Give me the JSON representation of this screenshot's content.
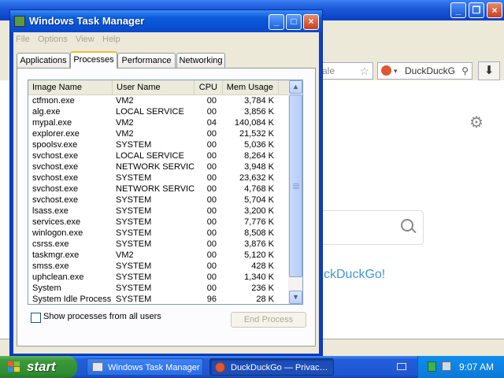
{
  "background_browser": {
    "url_fragment": "ale",
    "search_engine_label": "DuckDuckG",
    "tagline": "ckDuckGo!"
  },
  "task_manager": {
    "title": "Windows Task Manager",
    "menu": [
      "File",
      "Options",
      "View",
      "Help"
    ],
    "tabs": [
      "Applications",
      "Processes",
      "Performance",
      "Networking"
    ],
    "active_tab": "Processes",
    "columns": [
      "Image Name",
      "User Name",
      "CPU",
      "Mem Usage"
    ],
    "processes": [
      {
        "image": "ctfmon.exe",
        "user": "VM2",
        "cpu": "00",
        "mem": "3,784 K"
      },
      {
        "image": "alg.exe",
        "user": "LOCAL SERVICE",
        "cpu": "00",
        "mem": "3,856 K"
      },
      {
        "image": "mypal.exe",
        "user": "VM2",
        "cpu": "04",
        "mem": "140,084 K"
      },
      {
        "image": "explorer.exe",
        "user": "VM2",
        "cpu": "00",
        "mem": "21,532 K"
      },
      {
        "image": "spoolsv.exe",
        "user": "SYSTEM",
        "cpu": "00",
        "mem": "5,036 K"
      },
      {
        "image": "svchost.exe",
        "user": "LOCAL SERVICE",
        "cpu": "00",
        "mem": "8,264 K"
      },
      {
        "image": "svchost.exe",
        "user": "NETWORK SERVICE",
        "cpu": "00",
        "mem": "3,948 K"
      },
      {
        "image": "svchost.exe",
        "user": "SYSTEM",
        "cpu": "00",
        "mem": "23,632 K"
      },
      {
        "image": "svchost.exe",
        "user": "NETWORK SERVICE",
        "cpu": "00",
        "mem": "4,768 K"
      },
      {
        "image": "svchost.exe",
        "user": "SYSTEM",
        "cpu": "00",
        "mem": "5,704 K"
      },
      {
        "image": "lsass.exe",
        "user": "SYSTEM",
        "cpu": "00",
        "mem": "3,200 K"
      },
      {
        "image": "services.exe",
        "user": "SYSTEM",
        "cpu": "00",
        "mem": "7,776 K"
      },
      {
        "image": "winlogon.exe",
        "user": "SYSTEM",
        "cpu": "00",
        "mem": "8,508 K"
      },
      {
        "image": "csrss.exe",
        "user": "SYSTEM",
        "cpu": "00",
        "mem": "3,876 K"
      },
      {
        "image": "taskmgr.exe",
        "user": "VM2",
        "cpu": "00",
        "mem": "5,120 K"
      },
      {
        "image": "smss.exe",
        "user": "SYSTEM",
        "cpu": "00",
        "mem": "428 K"
      },
      {
        "image": "uphclean.exe",
        "user": "SYSTEM",
        "cpu": "00",
        "mem": "1,340 K"
      },
      {
        "image": "System",
        "user": "SYSTEM",
        "cpu": "00",
        "mem": "236 K"
      },
      {
        "image": "System Idle Process",
        "user": "SYSTEM",
        "cpu": "96",
        "mem": "28 K"
      }
    ],
    "show_all_users_label": "Show processes from all users",
    "show_all_users_checked": false,
    "end_process_label": "End Process"
  },
  "taskbar": {
    "start_label": "start",
    "tasks": [
      {
        "label": "Windows Task Manager",
        "active": false
      },
      {
        "label": "DuckDuckGo — Privac…",
        "active": true
      }
    ],
    "clock": "9:07 AM"
  },
  "colors": {
    "xp_title_blue": "#0a48cc",
    "start_green": "#3c9a3c",
    "ddg_orange": "#de5833",
    "ddg_blue": "#4495d4"
  }
}
